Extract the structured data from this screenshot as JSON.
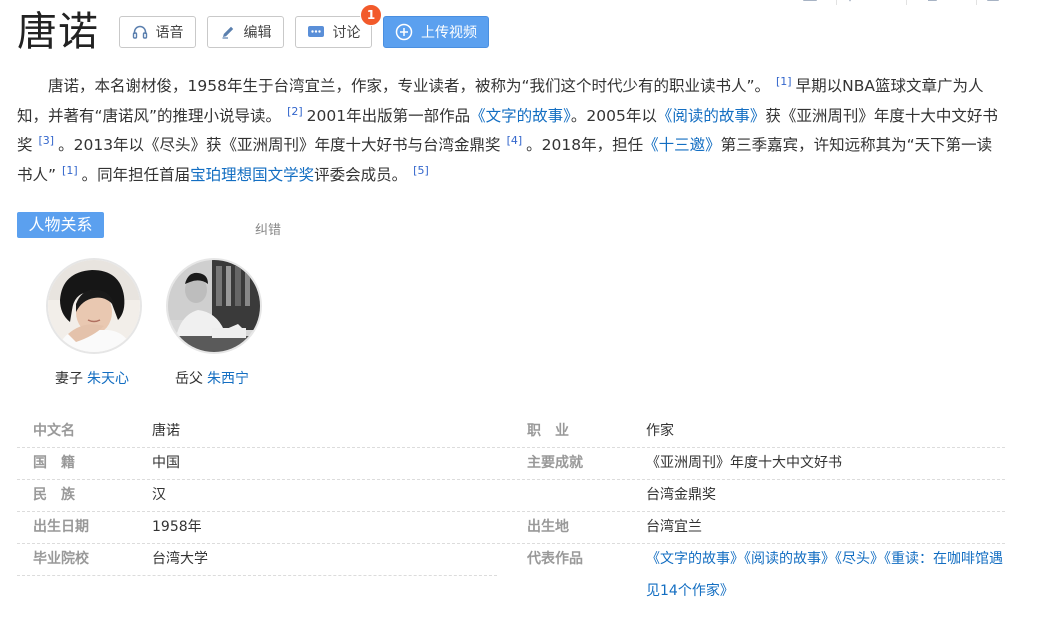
{
  "entry": {
    "title": "唐诺"
  },
  "toolbar": {
    "voice_label": "语音",
    "edit_label": "编辑",
    "discuss_label": "讨论",
    "discuss_badge": "1",
    "upload_label": "上传视频",
    "icons": [
      "headphones-icon",
      "pencil-icon",
      "chat-icon",
      "plus-circle-icon"
    ],
    "accent_color": "#5ba0ef"
  },
  "summary": {
    "s1": "唐诺，本名谢材俊，1958年生于台湾宜兰，作家，专业读者，被称为“我们这个时代少有的职业读书人”。",
    "ref1": "[1]",
    "s2": "早期以NBA篮球文章广为人知，并著有“唐诺风”的推理小说导读。",
    "ref2": "[2]",
    "s3": "2001年出版第一部作品",
    "book1": "《文字的故事》",
    "s4": "。2005年以",
    "book2": "《阅读的故事》",
    "s5": "获《亚洲周刊》年度十大中文好书奖",
    "ref3": "[3]",
    "s6": "。2013年以《尽头》获《亚洲周刊》年度十大好书与台湾金鼎奖",
    "ref4": "[4]",
    "s7": "。2018年，担任",
    "show": "《十三邀》",
    "s8": "第三季嘉宾，许知远称其为“天下第一读书人”",
    "ref5": "[1]",
    "s9": "。同年担任首届",
    "prize": "宝珀理想国文学奖",
    "s10": "评委会成员。",
    "ref6": "[5]"
  },
  "relations": {
    "tag": "人物关系",
    "correct": "纠错",
    "people": [
      {
        "relation": "妻子",
        "name": "朱天心"
      },
      {
        "relation": "岳父",
        "name": "朱西宁"
      }
    ]
  },
  "info": {
    "left": [
      {
        "label": "中文名",
        "value": "唐诺"
      },
      {
        "label": "国　籍",
        "value": "中国"
      },
      {
        "label": "民　族",
        "value": "汉"
      },
      {
        "label": "出生日期",
        "value": "1958年"
      },
      {
        "label": "毕业院校",
        "value": "台湾大学"
      }
    ],
    "right": [
      {
        "label": "职　业",
        "value": "作家"
      },
      {
        "label": "主要成就",
        "value": "《亚洲周刊》年度十大中文好书"
      },
      {
        "label": "",
        "value": "台湾金鼎奖"
      },
      {
        "label": "出生地",
        "value": "台湾宜兰"
      },
      {
        "label": "代表作品",
        "value": ""
      }
    ],
    "works": {
      "w1": "《文字的故事》",
      "w2": "《阅读的故事》",
      "w3": "《尽头》",
      "w4": "《重读：在咖啡馆遇见14个作家》"
    }
  }
}
